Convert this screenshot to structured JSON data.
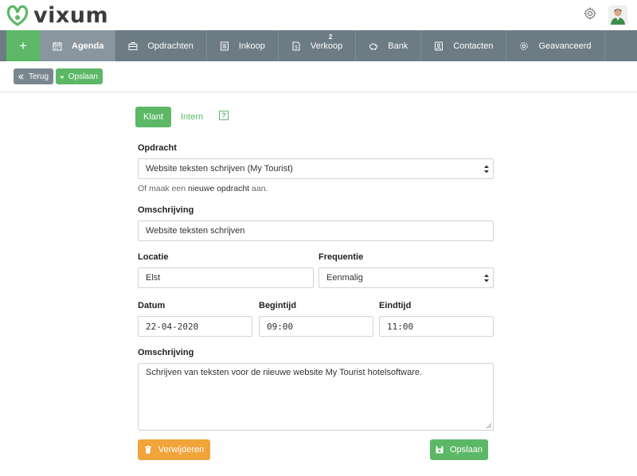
{
  "brand": {
    "name": "vixum",
    "color": "#5cb867"
  },
  "nav": {
    "add_label": "+",
    "items": [
      {
        "label": "Agenda",
        "icon": "calendar-icon",
        "active": true
      },
      {
        "label": "Opdrachten",
        "icon": "briefcase-icon"
      },
      {
        "label": "Inkoop",
        "icon": "document-icon"
      },
      {
        "label": "Verkoop",
        "icon": "invoice-icon",
        "badge": "2"
      },
      {
        "label": "Bank",
        "icon": "piggy-bank-icon"
      },
      {
        "label": "Contacten",
        "icon": "contact-icon"
      },
      {
        "label": "Geavanceerd",
        "icon": "gear-icon"
      }
    ]
  },
  "toolbar": {
    "back_label": "Terug",
    "save_label": "Opslaan"
  },
  "tabs": {
    "klant": "Klant",
    "intern": "Intern",
    "help": "?"
  },
  "form": {
    "opdracht_label": "Opdracht",
    "opdracht_value": "Website teksten schrijven (My Tourist)",
    "hint_prefix": "Of maak een ",
    "hint_link": "nieuwe opdracht",
    "hint_suffix": " aan.",
    "omschrijving_label": "Omschrijving",
    "omschrijving_value": "Website teksten schrijven",
    "locatie_label": "Locatie",
    "locatie_value": "Elst",
    "frequentie_label": "Frequentie",
    "frequentie_value": "Eenmalig",
    "datum_label": "Datum",
    "datum_value": "22-04-2020",
    "begintijd_label": "Begintijd",
    "begintijd_value": "09:00",
    "eindtijd_label": "Eindtijd",
    "eindtijd_value": "11:00",
    "notes_label": "Omschrijving",
    "notes_value": "Schrijven van teksten voor de nieuwe website My Tourist hotelsoftware."
  },
  "actions": {
    "delete_label": "Verwijderen",
    "save_label": "Opslaan"
  },
  "colors": {
    "green": "#5cb867",
    "orange": "#f0a43a",
    "nav": "#6d7b85"
  }
}
